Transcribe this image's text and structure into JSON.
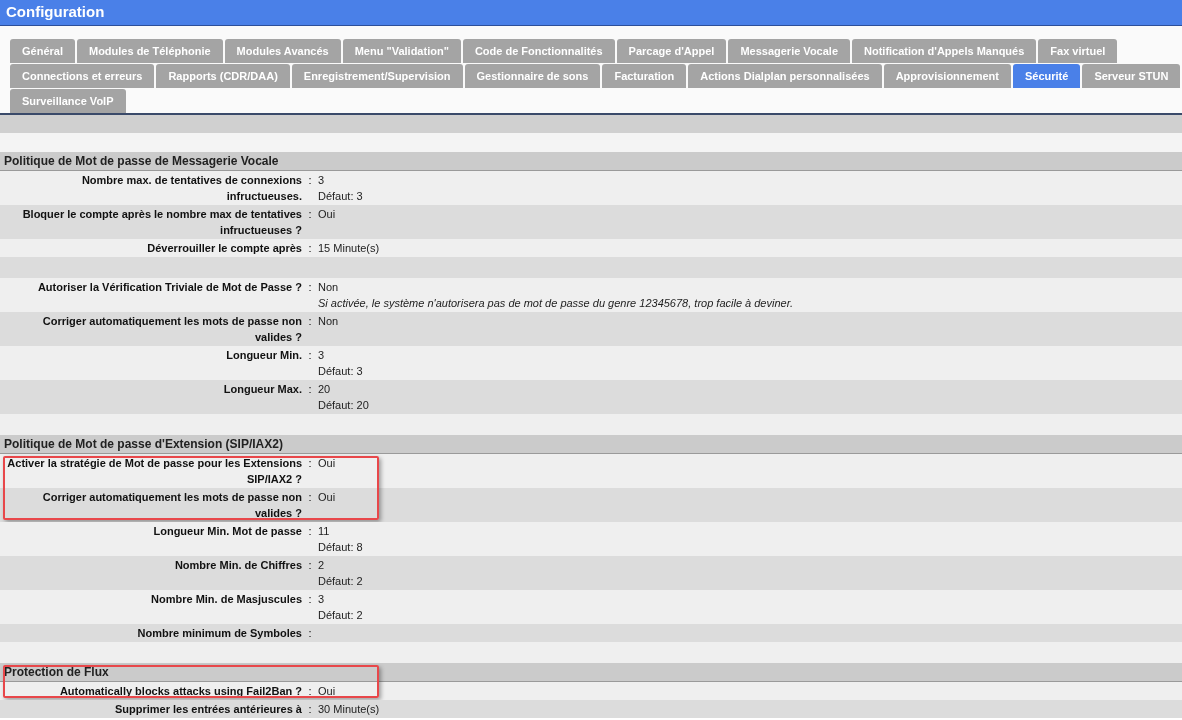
{
  "window": {
    "title": "Configuration"
  },
  "tab_rows": [
    [
      {
        "label": "Général",
        "selected": false
      },
      {
        "label": "Modules de Téléphonie",
        "selected": false
      },
      {
        "label": "Modules Avancés",
        "selected": false
      },
      {
        "label": "Menu \"Validation\"",
        "selected": false
      },
      {
        "label": "Code de Fonctionnalités",
        "selected": false
      },
      {
        "label": "Parcage d'Appel",
        "selected": false
      },
      {
        "label": "Messagerie Vocale",
        "selected": false
      },
      {
        "label": "Notification d'Appels Manqués",
        "selected": false
      },
      {
        "label": "Fax virtuel",
        "selected": false
      }
    ],
    [
      {
        "label": "Connections et erreurs",
        "selected": false
      },
      {
        "label": "Rapports (CDR/DAA)",
        "selected": false
      },
      {
        "label": "Enregistrement/Supervision",
        "selected": false
      },
      {
        "label": "Gestionnaire de sons",
        "selected": false
      },
      {
        "label": "Facturation",
        "selected": false
      },
      {
        "label": "Actions Dialplan personnalisées",
        "selected": false
      },
      {
        "label": "Approvisionnement",
        "selected": false
      },
      {
        "label": "Sécurité",
        "selected": true
      },
      {
        "label": "Serveur STUN",
        "selected": false
      }
    ],
    [
      {
        "label": "Surveillance VoIP",
        "selected": false
      }
    ]
  ],
  "label_separator": ":",
  "sections": [
    {
      "title": "Politique de Mot de passe de Messagerie Vocale",
      "highlighted": false,
      "rows": [
        {
          "kind": "setting",
          "label": "Nombre max. de tentatives de connexions infructueuses.",
          "value": "3",
          "default": "Défaut: 3",
          "highlighted": false
        },
        {
          "kind": "setting",
          "label": "Bloquer le compte après le nombre max de tentatives infructueuses ?",
          "value": "Oui",
          "highlighted": false
        },
        {
          "kind": "setting",
          "label": "Déverrouiller le compte après",
          "value": "15 Minute(s)",
          "highlighted": false
        },
        {
          "kind": "blank",
          "highlighted": false
        },
        {
          "kind": "setting",
          "label": "Autoriser la Vérification Triviale de Mot de Passe ?",
          "value": "Non",
          "note": "Si activée, le système n'autorisera pas de mot de passe du genre 12345678, trop facile à deviner.",
          "highlighted": false
        },
        {
          "kind": "setting",
          "label": "Corriger automatiquement les mots de passe non valides ?",
          "value": "Non",
          "highlighted": false
        },
        {
          "kind": "setting",
          "label": "Longueur Min.",
          "value": "3",
          "default": "Défaut: 3",
          "highlighted": false
        },
        {
          "kind": "setting",
          "label": "Longueur Max.",
          "value": "20",
          "default": "Défaut: 20",
          "highlighted": false
        },
        {
          "kind": "blank",
          "highlighted": false
        }
      ]
    },
    {
      "title": "Politique de Mot de passe d'Extension (SIP/IAX2)",
      "highlighted": false,
      "rows": [
        {
          "kind": "setting",
          "label": "Activer la stratégie de Mot de passe pour les Extensions SIP/IAX2 ?",
          "value": "Oui",
          "highlighted": true
        },
        {
          "kind": "setting",
          "label": "Corriger automatiquement les mots de passe non valides ?",
          "value": "Oui",
          "highlighted": true
        },
        {
          "kind": "setting",
          "label": "Longueur Min. Mot de passe",
          "value": "11",
          "default": "Défaut: 8",
          "highlighted": false
        },
        {
          "kind": "setting",
          "label": "Nombre Min. de Chiffres",
          "value": "2",
          "default": "Défaut: 2",
          "highlighted": false
        },
        {
          "kind": "setting",
          "label": "Nombre Min. de Masjuscules",
          "value": "3",
          "default": "Défaut: 2",
          "highlighted": false
        },
        {
          "kind": "setting",
          "label": "Nombre minimum de Symboles",
          "highlighted": false
        },
        {
          "kind": "blank",
          "highlighted": false
        }
      ]
    },
    {
      "title": "Protection de Flux",
      "highlighted": true,
      "rows": [
        {
          "kind": "setting",
          "label": "Automatically blocks attacks using Fail2Ban ?",
          "value": "Oui",
          "highlighted": true
        },
        {
          "kind": "setting",
          "label": "Supprimer les entrées antérieures à",
          "value": "30 Minute(s)",
          "highlighted": false
        }
      ]
    }
  ]
}
